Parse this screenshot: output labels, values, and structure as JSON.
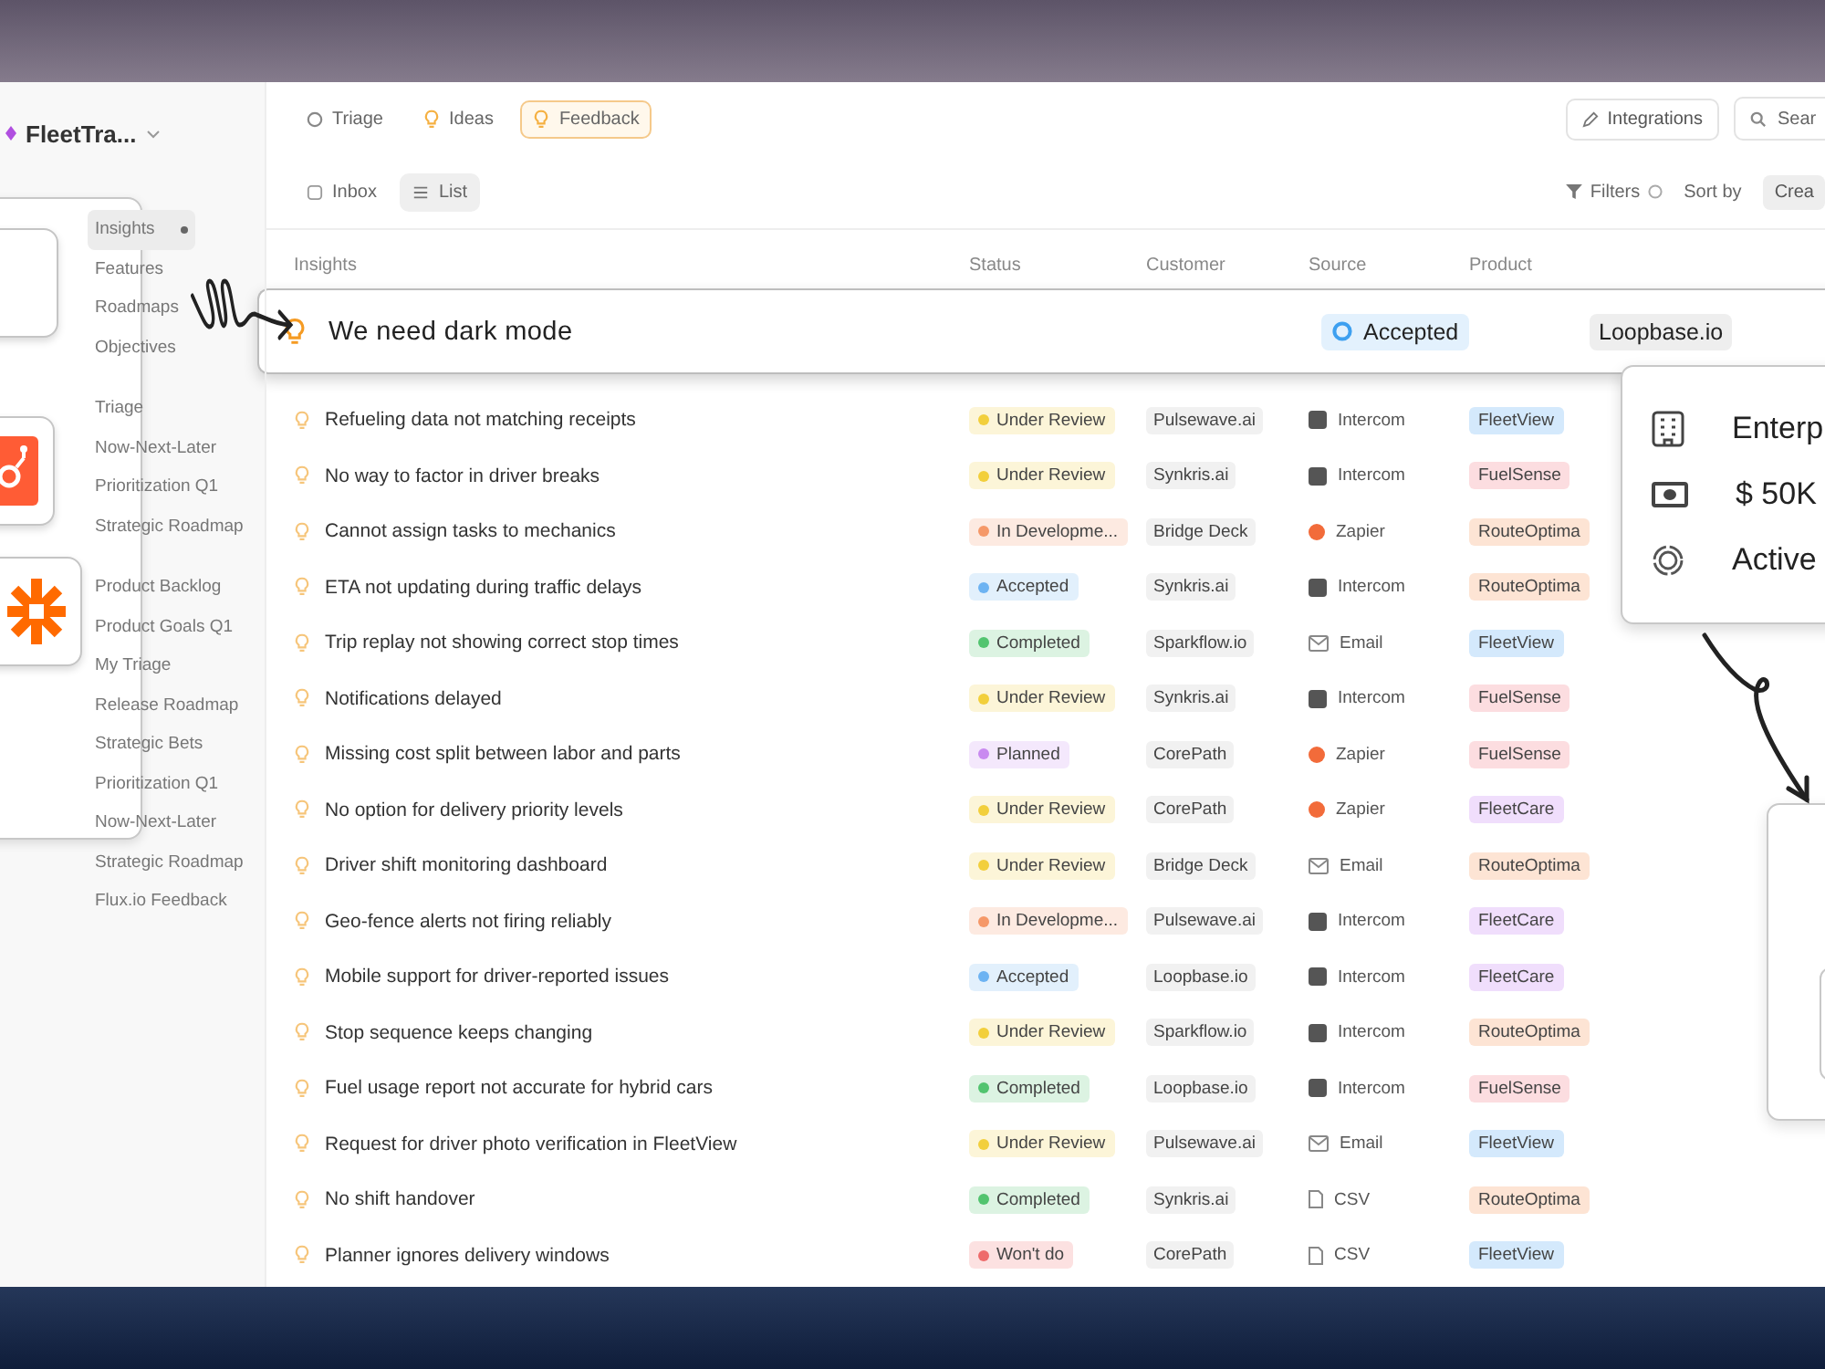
{
  "workspace": {
    "name": "FleetTra..."
  },
  "sidebar": {
    "groups": [
      {
        "items": [
          {
            "label": "Insights",
            "selected": true
          },
          {
            "label": "Features",
            "selected": false
          },
          {
            "label": "Roadmaps",
            "selected": false
          },
          {
            "label": "Objectives",
            "selected": false
          }
        ]
      },
      {
        "items": [
          {
            "label": "Triage",
            "selected": false
          },
          {
            "label": "Now-Next-Later",
            "selected": false
          },
          {
            "label": "Prioritization Q1",
            "selected": false
          },
          {
            "label": "Strategic Roadmap",
            "selected": false
          }
        ]
      },
      {
        "items": [
          {
            "label": "Product Backlog",
            "selected": false
          },
          {
            "label": "Product Goals Q1",
            "selected": false
          },
          {
            "label": "My Triage",
            "selected": false
          },
          {
            "label": "Release Roadmap",
            "selected": false
          },
          {
            "label": "Strategic Bets",
            "selected": false
          },
          {
            "label": "Prioritization Q1",
            "selected": false
          },
          {
            "label": "Now-Next-Later",
            "selected": false
          },
          {
            "label": "Strategic Roadmap",
            "selected": false
          },
          {
            "label": "Flux.io Feedback",
            "selected": false
          }
        ]
      }
    ]
  },
  "integrations_panel": {
    "tiles": [
      {
        "kind": "cropped"
      },
      {
        "kind": "hubspot"
      },
      {
        "kind": "zapier"
      }
    ]
  },
  "top_tabs": [
    {
      "label": "Triage",
      "kind": "triage",
      "selected": false
    },
    {
      "label": "Ideas",
      "kind": "ideas",
      "selected": false
    },
    {
      "label": "Feedback",
      "kind": "feedback",
      "selected": true
    }
  ],
  "integrations_button": {
    "label": "Integrations"
  },
  "search": {
    "placeholder": "Sear"
  },
  "view_tabs": [
    {
      "label": "Inbox",
      "kind": "inbox",
      "selected": false
    },
    {
      "label": "List",
      "kind": "list",
      "selected": true
    }
  ],
  "filters": {
    "label": "Filters"
  },
  "sort": {
    "label": "Sort by",
    "value": "Crea"
  },
  "table": {
    "columns": [
      "Insights",
      "Status",
      "Customer",
      "Source",
      "Product"
    ],
    "highlight": {
      "title": "We need dark mode",
      "status": "Accepted",
      "customer": "Loopbase.io"
    },
    "rows": [
      {
        "title": "Refueling data not matching receipts",
        "status": {
          "label": "Under Review",
          "color": "#f2cf3c"
        },
        "customer": "Pulsewave.ai",
        "source": {
          "label": "Intercom",
          "kind": "intercom"
        },
        "product": {
          "label": "FleetView",
          "color": "#d4e9fc"
        }
      },
      {
        "title": "No way to factor in driver breaks",
        "status": {
          "label": "Under Review",
          "color": "#f2cf3c"
        },
        "customer": "Synkris.ai",
        "source": {
          "label": "Intercom",
          "kind": "intercom"
        },
        "product": {
          "label": "FuelSense",
          "color": "#fcdde0"
        }
      },
      {
        "title": "Cannot assign tasks to mechanics",
        "status": {
          "label": "In Developme...",
          "color": "#f59868"
        },
        "customer": "Bridge Deck",
        "source": {
          "label": "Zapier",
          "kind": "zapier"
        },
        "product": {
          "label": "RouteOptima",
          "color": "#fde4d4"
        }
      },
      {
        "title": "ETA not updating during traffic delays",
        "status": {
          "label": "Accepted",
          "color": "#6db3f2"
        },
        "customer": "Synkris.ai",
        "source": {
          "label": "Intercom",
          "kind": "intercom"
        },
        "product": {
          "label": "RouteOptima",
          "color": "#fde4d4"
        }
      },
      {
        "title": "Trip replay not showing correct stop times",
        "status": {
          "label": "Completed",
          "color": "#52c46f"
        },
        "customer": "Sparkflow.io",
        "source": {
          "label": "Email",
          "kind": "email"
        },
        "product": {
          "label": "FleetView",
          "color": "#d4e9fc"
        }
      },
      {
        "title": "Notifications delayed",
        "status": {
          "label": "Under Review",
          "color": "#f2cf3c"
        },
        "customer": "Synkris.ai",
        "source": {
          "label": "Intercom",
          "kind": "intercom"
        },
        "product": {
          "label": "FuelSense",
          "color": "#fcdde0"
        }
      },
      {
        "title": "Missing cost split between labor and parts",
        "status": {
          "label": "Planned",
          "color": "#c98af0"
        },
        "customer": "CorePath",
        "source": {
          "label": "Zapier",
          "kind": "zapier"
        },
        "product": {
          "label": "FuelSense",
          "color": "#fcdde0"
        }
      },
      {
        "title": "No option for delivery priority levels",
        "status": {
          "label": "Under Review",
          "color": "#f2cf3c"
        },
        "customer": "CorePath",
        "source": {
          "label": "Zapier",
          "kind": "zapier"
        },
        "product": {
          "label": "FleetCare",
          "color": "#f0defc"
        }
      },
      {
        "title": "Driver shift monitoring dashboard",
        "status": {
          "label": "Under Review",
          "color": "#f2cf3c"
        },
        "customer": "Bridge Deck",
        "source": {
          "label": "Email",
          "kind": "email"
        },
        "product": {
          "label": "RouteOptima",
          "color": "#fde4d4"
        }
      },
      {
        "title": "Geo-fence alerts not firing reliably",
        "status": {
          "label": "In Developme...",
          "color": "#f59868"
        },
        "customer": "Pulsewave.ai",
        "source": {
          "label": "Intercom",
          "kind": "intercom"
        },
        "product": {
          "label": "FleetCare",
          "color": "#f0defc"
        }
      },
      {
        "title": "Mobile support for driver-reported issues",
        "status": {
          "label": "Accepted",
          "color": "#6db3f2"
        },
        "customer": "Loopbase.io",
        "source": {
          "label": "Intercom",
          "kind": "intercom"
        },
        "product": {
          "label": "FleetCare",
          "color": "#f0defc"
        }
      },
      {
        "title": "Stop sequence keeps changing",
        "status": {
          "label": "Under Review",
          "color": "#f2cf3c"
        },
        "customer": "Sparkflow.io",
        "source": {
          "label": "Intercom",
          "kind": "intercom"
        },
        "product": {
          "label": "RouteOptima",
          "color": "#fde4d4"
        }
      },
      {
        "title": "Fuel usage report not accurate for hybrid cars",
        "status": {
          "label": "Completed",
          "color": "#52c46f"
        },
        "customer": "Loopbase.io",
        "source": {
          "label": "Intercom",
          "kind": "intercom"
        },
        "product": {
          "label": "FuelSense",
          "color": "#fcdde0"
        }
      },
      {
        "title": "Request for driver photo verification in FleetView",
        "status": {
          "label": "Under Review",
          "color": "#f2cf3c"
        },
        "customer": "Pulsewave.ai",
        "source": {
          "label": "Email",
          "kind": "email"
        },
        "product": {
          "label": "FleetView",
          "color": "#d4e9fc"
        }
      },
      {
        "title": "No shift handover",
        "status": {
          "label": "Completed",
          "color": "#52c46f"
        },
        "customer": "Synkris.ai",
        "source": {
          "label": "CSV",
          "kind": "csv"
        },
        "product": {
          "label": "RouteOptima",
          "color": "#fde4d4"
        }
      },
      {
        "title": "Planner ignores delivery windows",
        "status": {
          "label": "Won't do",
          "color": "#ee6b6b"
        },
        "customer": "CorePath",
        "source": {
          "label": "CSV",
          "kind": "csv"
        },
        "product": {
          "label": "FleetView",
          "color": "#d4e9fc"
        }
      }
    ]
  },
  "customer_card": {
    "rows": [
      {
        "kind": "company",
        "text": "Enterp"
      },
      {
        "kind": "revenue",
        "text": "$ 50K"
      },
      {
        "kind": "status",
        "text": "Active"
      }
    ]
  }
}
